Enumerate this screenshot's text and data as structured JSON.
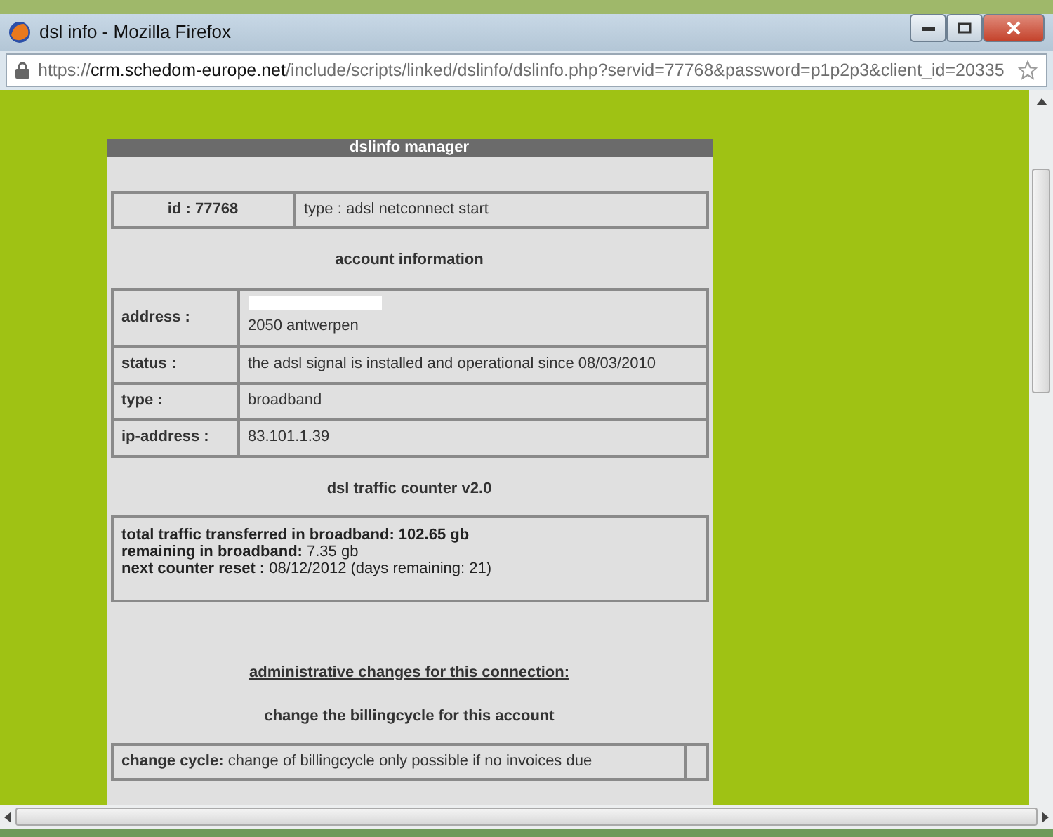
{
  "window": {
    "title": "dsl info - Mozilla Firefox"
  },
  "address_bar": {
    "scheme": "https://",
    "host": "crm.schedom-europe.net",
    "path": "/include/scripts/linked/dslinfo/dslinfo.php?servid=77768&password=p1p2p3&client_id=20335"
  },
  "panel": {
    "title": "dslinfo manager",
    "id_text": "id : 77768",
    "type_text": "type : adsl netconnect start",
    "account_heading": "account information",
    "account_rows": [
      {
        "label": "address :",
        "value": "2050 antwerpen",
        "redacted": true
      },
      {
        "label": "status :",
        "value": "the adsl signal is installed and operational since 08/03/2010",
        "redacted": false
      },
      {
        "label": "type :",
        "value": "broadband",
        "redacted": false
      },
      {
        "label": "ip-address :",
        "value": "83.101.1.39",
        "redacted": false
      }
    ],
    "traffic_heading": "dsl traffic counter v2.0",
    "traffic_lines": [
      {
        "label": "total traffic transferred in broadband:",
        "value": "102.65 gb",
        "value_bold": true
      },
      {
        "label": "remaining in broadband:",
        "value": "7.35 gb",
        "value_bold": false
      },
      {
        "label": "next counter reset :",
        "value": "08/12/2012 (days remaining: 21)",
        "value_bold": false
      }
    ],
    "admin_link": "administrative changes for this connection:",
    "billing_heading": "change the billingcycle for this account",
    "cycle_label": "change cycle:",
    "cycle_text": "change of billingcycle only possible if no invoices due"
  }
}
